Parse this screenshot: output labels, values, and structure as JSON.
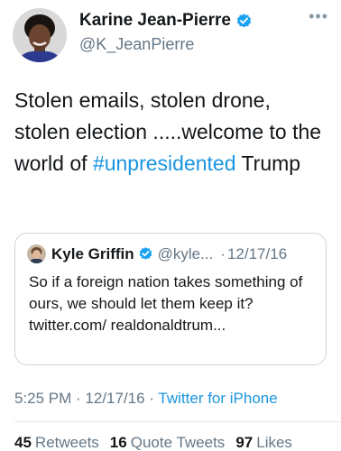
{
  "author": {
    "name": "Karine Jean-Pierre",
    "handle": "@K_JeanPierre",
    "verified": true,
    "avatar_icon": "profile-photo"
  },
  "more_icon": "more-options-icon",
  "tweet": {
    "text_before": "Stolen emails, stolen drone, stolen election .....welcome to the world of ",
    "hashtag": "#unpresidented",
    "text_after": " Trump"
  },
  "quoted": {
    "name": "Kyle Griffin",
    "handle": "@kyle...",
    "separator": "·",
    "date": "12/17/16",
    "text": "So if a foreign nation takes something of ours, we should let them keep it? twitter.com/ realdonaldtrum..."
  },
  "meta": {
    "time": "5:25 PM",
    "separator1": " · ",
    "date": "12/17/16",
    "separator2": " · ",
    "source": "Twitter for iPhone"
  },
  "stats": {
    "retweets_count": "45",
    "retweets_label": "Retweets",
    "quotes_count": "16",
    "quotes_label": "Quote Tweets",
    "likes_count": "97",
    "likes_label": "Likes"
  },
  "colors": {
    "link": "#1b95e0",
    "secondary_text": "#657786",
    "verified_badge": "#1da1f2",
    "border": "#ccd6dd"
  }
}
